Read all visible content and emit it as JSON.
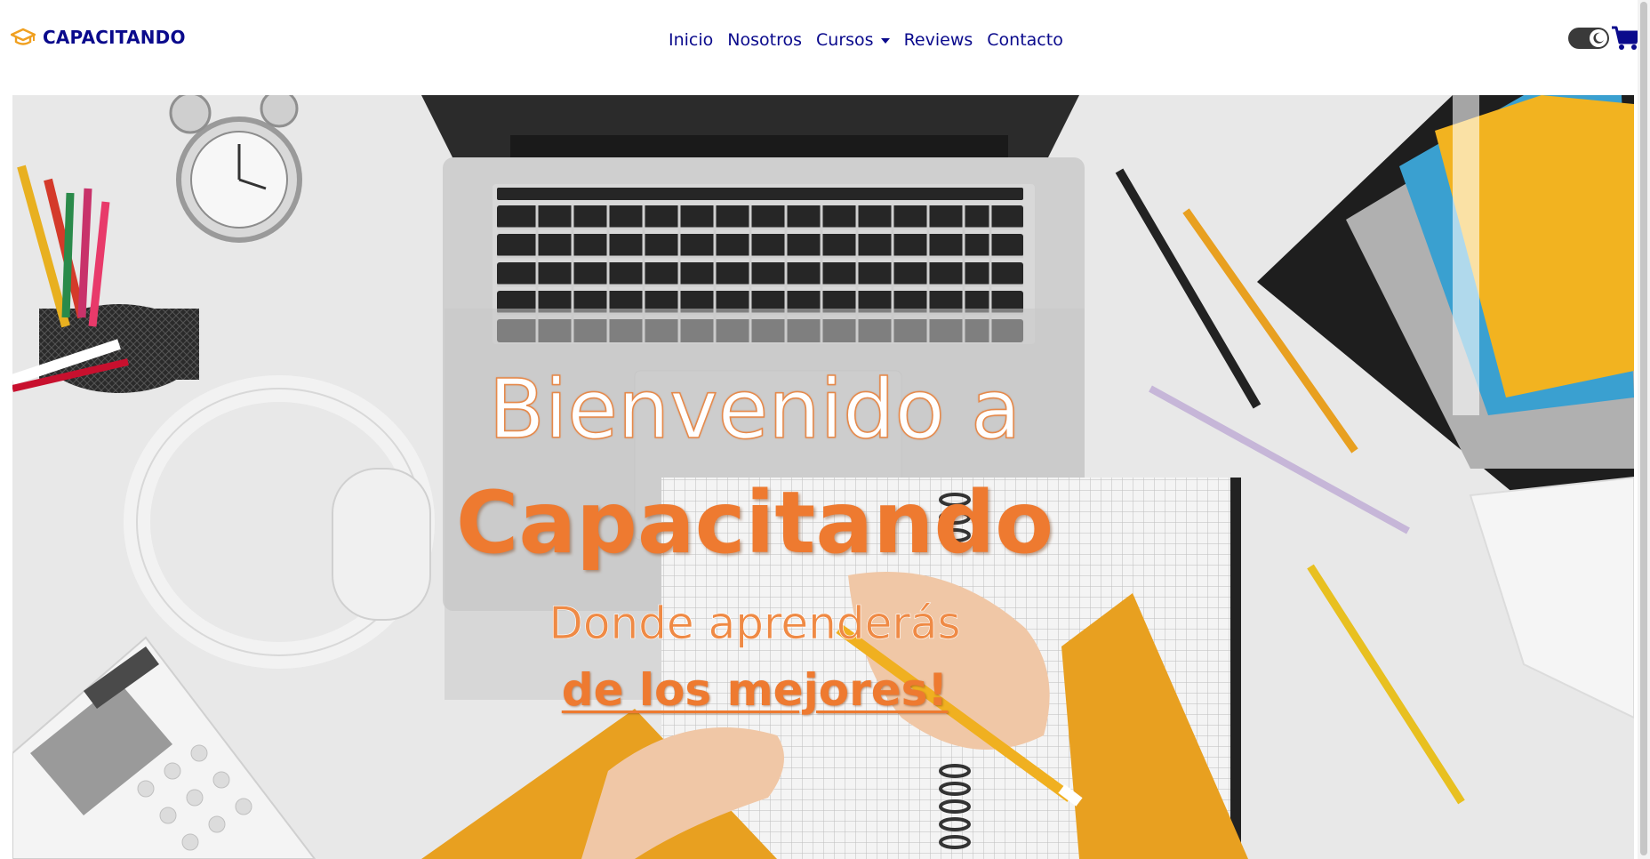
{
  "brand": {
    "name": "CAPACITANDO",
    "icon": "graduation-cap-icon",
    "icon_color": "#f0a020",
    "text_color": "#0a0a8c"
  },
  "nav": {
    "items": [
      {
        "label": "Inicio"
      },
      {
        "label": "Nosotros"
      },
      {
        "label": "Cursos",
        "has_dropdown": true
      },
      {
        "label": "Reviews"
      },
      {
        "label": "Contacto"
      }
    ],
    "link_color": "#0a0a8c"
  },
  "toolbar": {
    "theme_toggle_icon": "moon-icon",
    "cart_icon": "shopping-cart-icon"
  },
  "hero": {
    "line1": "Bienvenido a",
    "line2": "Capacitando",
    "line3": "Donde aprenderás",
    "line4": "de los mejores!",
    "accent_color": "#ee7a30"
  }
}
